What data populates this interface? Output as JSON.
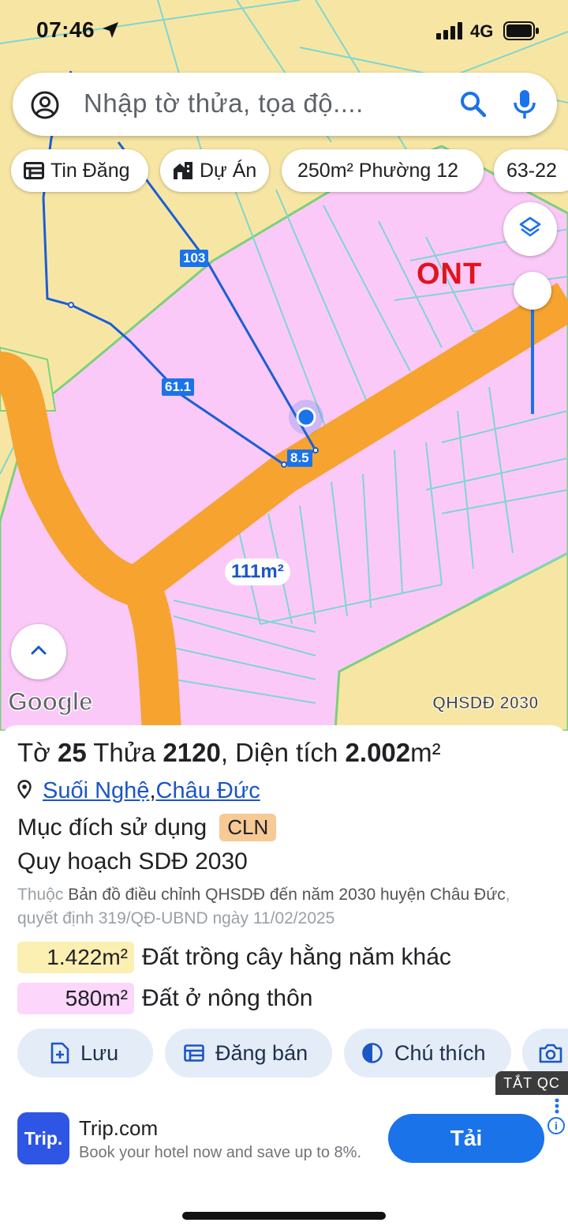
{
  "status": {
    "time": "07:46",
    "network": "4G"
  },
  "search": {
    "placeholder": "Nhập tờ thửa, tọa độ...."
  },
  "chips": [
    {
      "label": "Tin Đăng",
      "icon": "listing-icon"
    },
    {
      "label": "Dự Án",
      "icon": "buildings-icon"
    },
    {
      "label": "250m² Phường 12"
    },
    {
      "label": "63-22"
    }
  ],
  "map": {
    "zone_label": "ONT",
    "area_label": "111m²",
    "dimensions": [
      "103",
      "61.1",
      "8.5"
    ],
    "brand": "Google",
    "map_source": "QHSDĐ 2030",
    "colors": {
      "agricultural": "#f7e6a3",
      "residential": "#fbc9f8",
      "road": "#f6a330",
      "parcel_line": "#1a5ed8"
    }
  },
  "parcel": {
    "title_prefix": "Tờ ",
    "sheet": "25",
    "title_mid1": " Thửa ",
    "lot": "2120",
    "title_mid2": ", Diện tích ",
    "area": "2.002",
    "area_unit": "m²",
    "commune": "Suối Nghệ",
    "separator": ", ",
    "district": "Châu Đức",
    "purpose_label": "Mục đích sử dụng",
    "purpose_code": "CLN",
    "plan_title": "Quy hoạch SDĐ 2030",
    "plan_prefix": "Thuộc ",
    "plan_name": "Bản đồ điều chỉnh QHSDĐ đến năm 2030 huyện Châu Đức",
    "plan_decision": ", quyết định 319/QĐ-UBND ngày 11/02/2025",
    "land_uses": [
      {
        "amount": "1.422m²",
        "description": "Đất trồng cây hằng năm khác",
        "color": "#fbefb2"
      },
      {
        "amount": "580m²",
        "description": "Đất ở nông thôn",
        "color": "#fcd6fb"
      }
    ]
  },
  "actions": [
    {
      "label": "Lưu",
      "icon": "save-icon"
    },
    {
      "label": "Đăng bán",
      "icon": "listing-icon"
    },
    {
      "label": "Chú thích",
      "icon": "contrast-icon"
    },
    {
      "label": "",
      "icon": "camera-icon"
    }
  ],
  "ad": {
    "close_label": "TẮT QC",
    "logo_text": "Trip.",
    "title": "Trip.com",
    "subtitle": "Book your hotel now and save up to 8%.",
    "cta": "Tải",
    "info": "i"
  }
}
